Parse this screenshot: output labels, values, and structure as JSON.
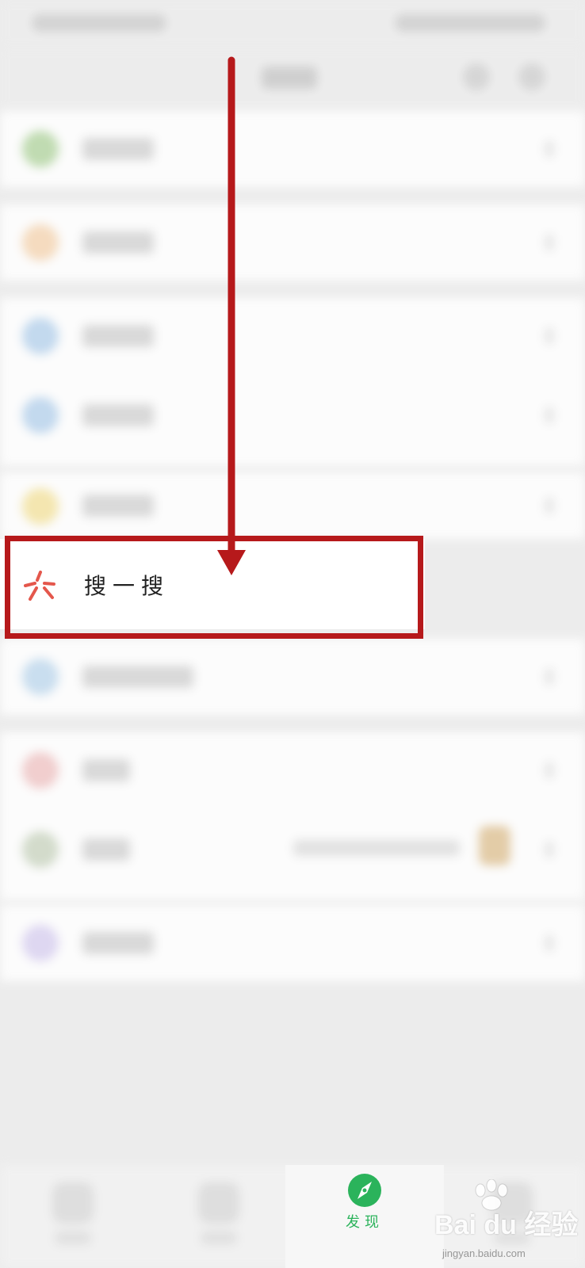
{
  "highlighted_item": {
    "label": "搜一搜",
    "icon": "search-sparkle-icon",
    "icon_color": "#e4574c"
  },
  "annotation": {
    "color": "#b6191b",
    "type": "arrow-and-box"
  },
  "bottom_nav": {
    "active_label": "发现",
    "active_icon": "compass-icon",
    "active_color": "#2bb35b"
  },
  "watermark": {
    "brand": "Bai du 经验",
    "url": "jingyan.baidu.com"
  }
}
